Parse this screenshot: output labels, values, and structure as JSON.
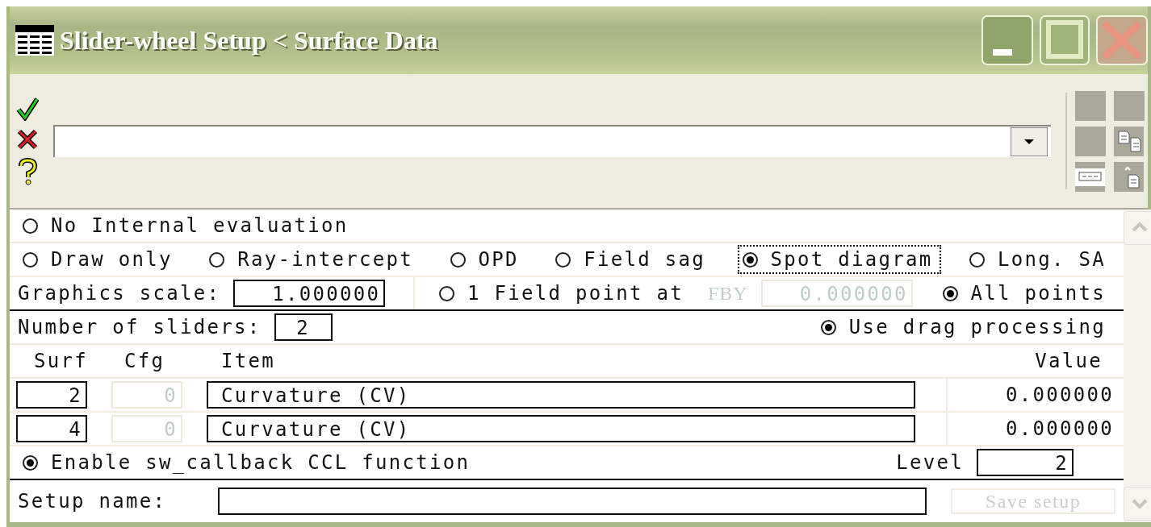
{
  "window": {
    "title": "Slider-wheel Setup < Surface Data"
  },
  "evaluation": {
    "none": {
      "label": "No Internal evaluation",
      "selected": false
    },
    "modes": [
      {
        "label": "Draw only",
        "selected": false,
        "focused": false
      },
      {
        "label": "Ray-intercept",
        "selected": false,
        "focused": false
      },
      {
        "label": "OPD",
        "selected": false,
        "focused": false
      },
      {
        "label": "Field sag",
        "selected": false,
        "focused": false
      },
      {
        "label": "Spot diagram",
        "selected": true,
        "focused": true
      },
      {
        "label": "Long. SA",
        "selected": false,
        "focused": false
      }
    ]
  },
  "graphics_scale": {
    "label": "Graphics scale:",
    "value": "1.000000"
  },
  "field_points": [
    {
      "kind": "single",
      "label": "1 Field point at",
      "selected": false,
      "field_label": "FBY",
      "value": "0.000000",
      "disabled": true
    },
    {
      "kind": "all",
      "label": "All points",
      "selected": true
    }
  ],
  "sliders": {
    "label": "Number of sliders:",
    "value": "2"
  },
  "drag_processing": {
    "label": "Use drag processing",
    "selected": true
  },
  "table": {
    "columns": [
      "Surf",
      "Cfg",
      "Item",
      "Value"
    ],
    "rows": [
      {
        "surf": "2",
        "cfg": "0",
        "cfg_disabled": true,
        "item": "Curvature (CV)",
        "value": "0.000000"
      },
      {
        "surf": "4",
        "cfg": "0",
        "cfg_disabled": true,
        "item": "Curvature (CV)",
        "value": "0.000000"
      }
    ]
  },
  "callback": {
    "label": "Enable sw_callback CCL function",
    "selected": true
  },
  "level": {
    "label": "Level",
    "value": "2"
  },
  "setup": {
    "label": "Setup name:",
    "button": {
      "label": "Save setup",
      "disabled": true
    }
  }
}
